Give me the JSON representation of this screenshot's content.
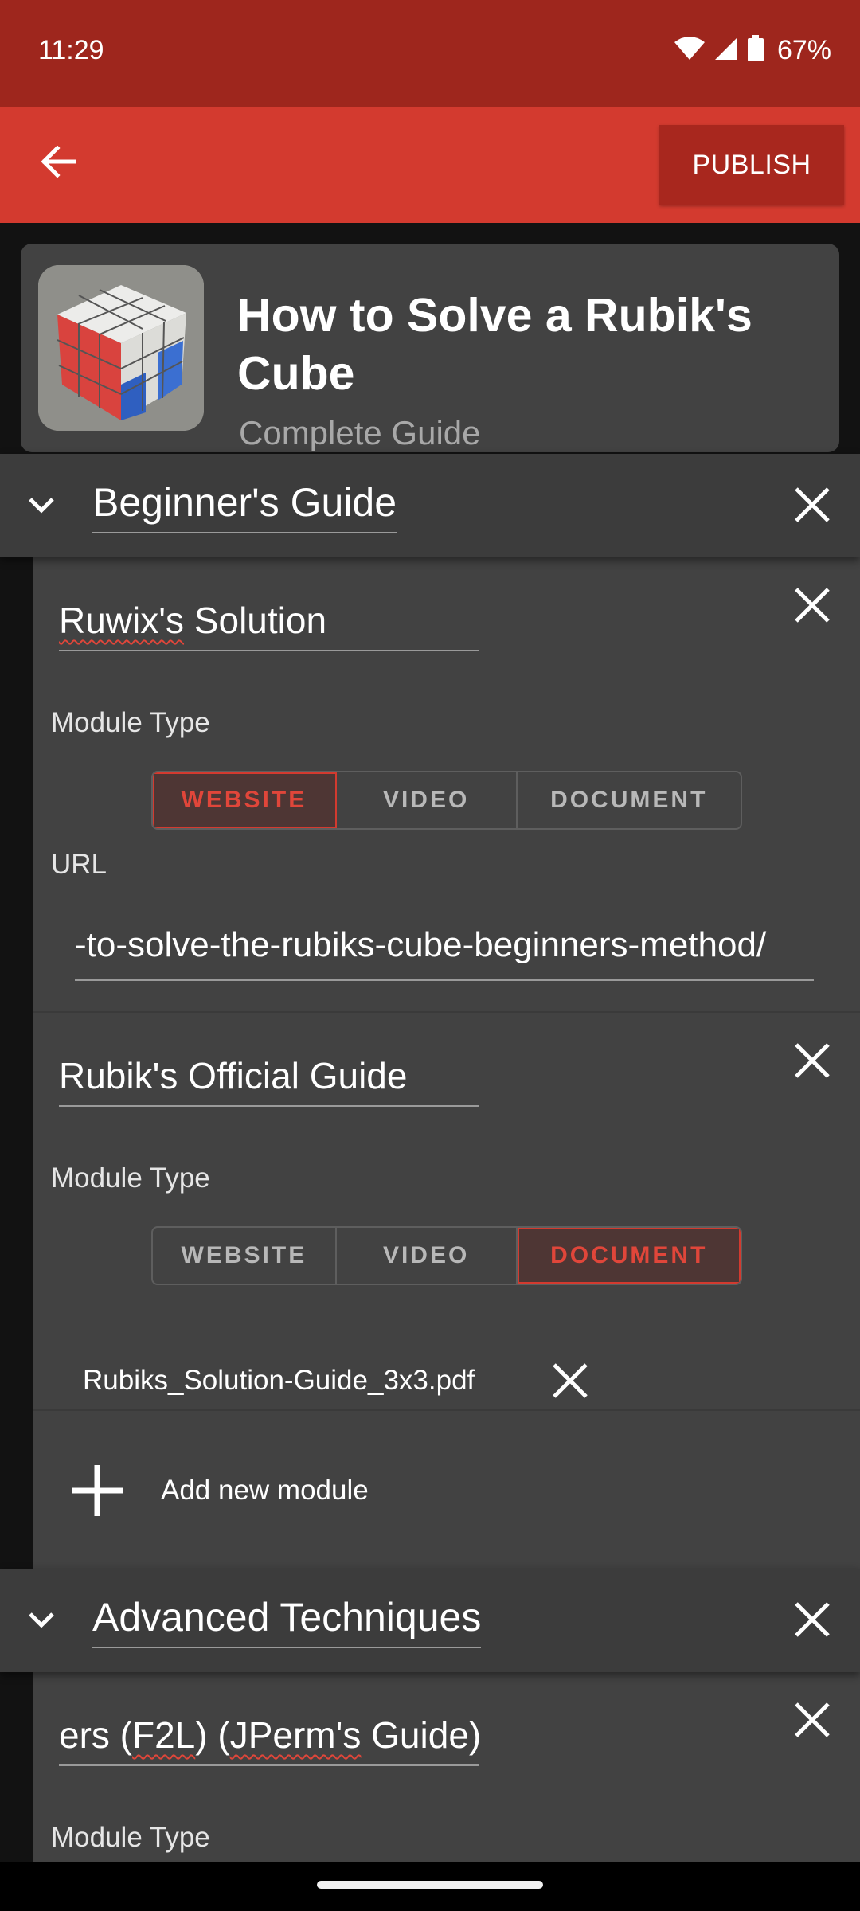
{
  "status_bar": {
    "time": "11:29",
    "battery_percent": "67%",
    "icons": [
      "wifi-icon",
      "cell-signal-icon",
      "battery-icon"
    ]
  },
  "app_bar": {
    "back_icon": "arrow-left-icon",
    "publish_label": "PUBLISH"
  },
  "guide": {
    "title": "How to Solve a Rubik's Cube",
    "subtitle": "Complete Guide",
    "thumbnail": "rubiks-cube-photo"
  },
  "sections": [
    {
      "title": "Beginner's Guide",
      "modules": [
        {
          "title": "Ruwix's Solution",
          "module_type_label": "Module Type",
          "types": [
            "WEBSITE",
            "VIDEO",
            "DOCUMENT"
          ],
          "selected_type": "WEBSITE",
          "url_label": "URL",
          "url_value": "-to-solve-the-rubiks-cube-beginners-method/"
        },
        {
          "title": "Rubik's Official Guide",
          "module_type_label": "Module Type",
          "types": [
            "WEBSITE",
            "VIDEO",
            "DOCUMENT"
          ],
          "selected_type": "DOCUMENT",
          "file_name": "Rubiks_Solution-Guide_3x3.pdf"
        }
      ],
      "add_module_label": "Add new module"
    },
    {
      "title": "Advanced Techniques",
      "modules": [
        {
          "title_visible": "ers (F2L) (JPerm's Guide)",
          "module_type_label": "Module Type"
        }
      ]
    }
  ],
  "colors": {
    "status_bar": "#9e261d",
    "app_bar": "#d33a2f",
    "publish_button": "#a8271e",
    "surface": "#424242",
    "background": "#121212",
    "accent": "#e0463a"
  }
}
